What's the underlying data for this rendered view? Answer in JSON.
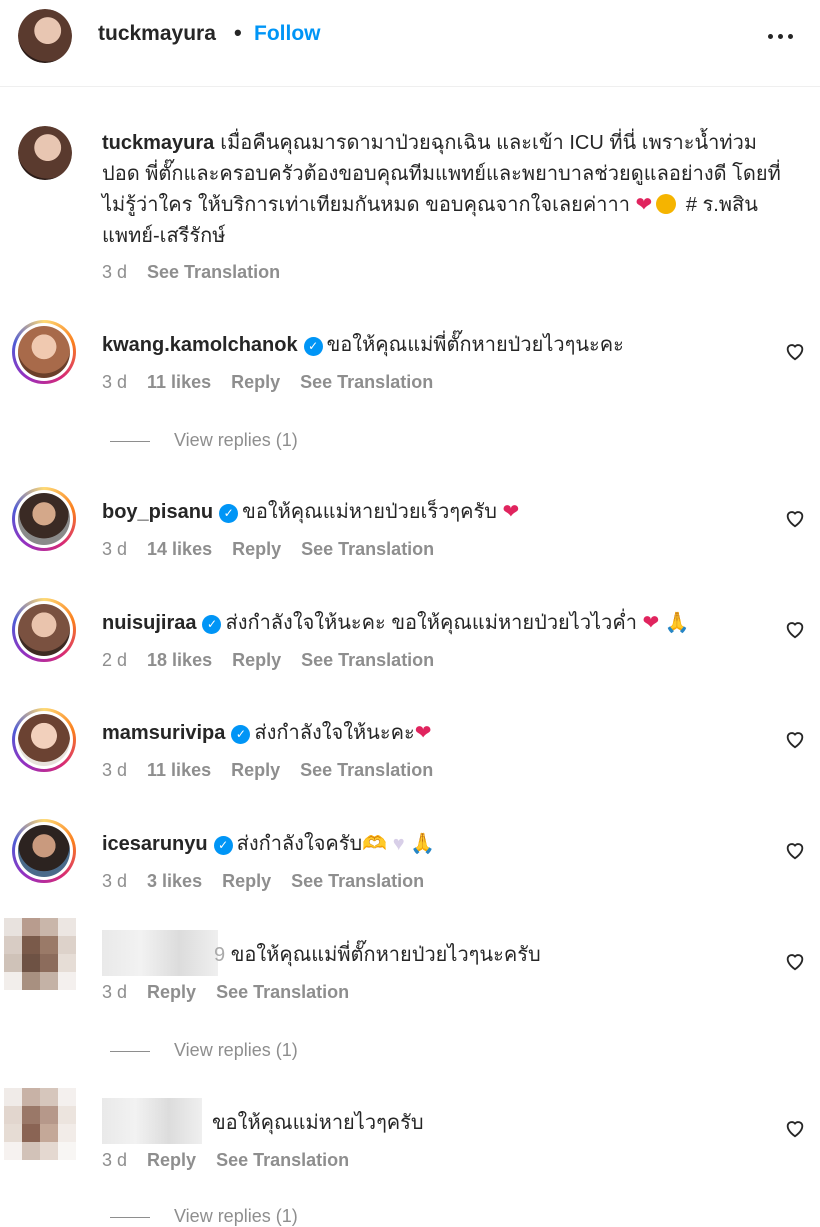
{
  "header": {
    "username": "tuckmayura",
    "separator": "•",
    "follow_label": "Follow"
  },
  "caption": {
    "username": "tuckmayura",
    "text": "เมื่อคืนคุณมารดามาป่วยฉุกเฉิน และเข้า ICU ที่นี่ เพราะน้ำท่วมปอด พี่ตั๊กและครอบครัวต้องขอบคุณทีมแพทย์และพยาบาลช่วยดูแลอย่างดี โดยที่ไม่รู้ว่าใคร ให้บริการเท่าเทียมกันหมด ขอบคุณจากใจเลยค่าาา",
    "hashtag": "# ร.พสินแพทย์-เสรีรักษ์",
    "time": "3 d",
    "see_translation": "See Translation"
  },
  "labels": {
    "reply": "Reply",
    "see_translation": "See Translation",
    "view_replies": "View replies (1)"
  },
  "comments": [
    {
      "username": "kwang.kamolchanok",
      "text": "ขอให้คุณแม่พี่ตั๊กหายป่วยไวๆนะคะ",
      "time": "3 d",
      "likes": "11 likes"
    },
    {
      "username": "boy_pisanu",
      "text": "ขอให้คุณแม่หายป่วยเร็วๆครับ",
      "time": "3 d",
      "likes": "14 likes"
    },
    {
      "username": "nuisujiraa",
      "text": "ส่งกำลังใจให้นะคะ ขอให้คุณแม่หายป่วยไวไวค่ำ",
      "time": "2 d",
      "likes": "18 likes"
    },
    {
      "username": "mamsurivipa",
      "text": "ส่งกำลังใจให้นะคะ",
      "time": "3 d",
      "likes": "11 likes"
    },
    {
      "username": "icesarunyu",
      "text": "ส่งกำลังใจครับ",
      "time": "3 d",
      "likes": "3 likes"
    },
    {
      "username_fragment": "9",
      "text": "ขอให้คุณแม่พี่ตั๊กหายป่วยไวๆนะครับ",
      "time": "3 d"
    },
    {
      "text": "ขอให้คุณแม่หายไวๆครับ",
      "time": "3 d"
    }
  ],
  "colors": {
    "accent": "#0095f6",
    "text": "#262626",
    "muted": "#8e8e8e",
    "heart": "#e0245e"
  },
  "icons": {
    "more": "more-horizontal-icon",
    "like": "heart-outline-icon",
    "verified": "verified-badge-icon"
  }
}
